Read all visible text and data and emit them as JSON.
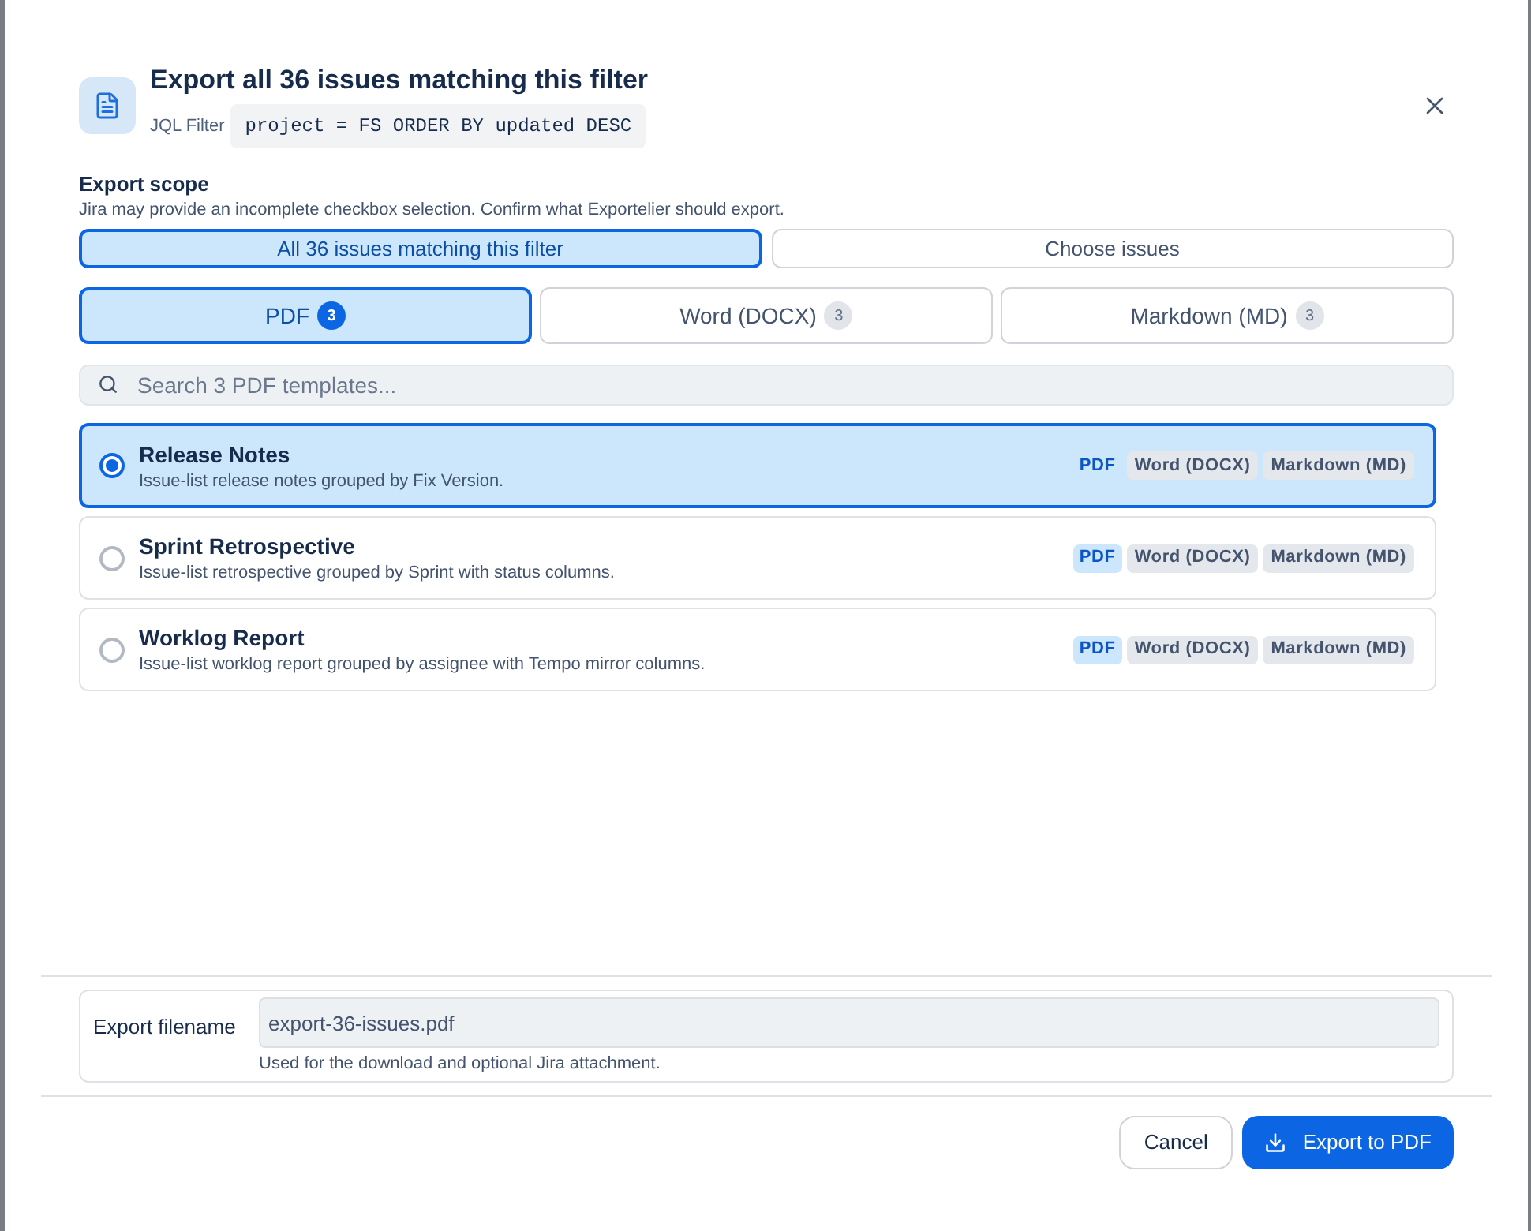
{
  "dialog": {
    "title": "Export all 36 issues matching this filter",
    "filter_label": "JQL Filter",
    "filter_query": "project = FS ORDER BY updated DESC"
  },
  "scope": {
    "heading": "Export scope",
    "hint": "Jira may provide an incomplete checkbox selection. Confirm what Exportelier should export.",
    "options": [
      {
        "label": "All 36 issues matching this filter",
        "selected": true
      },
      {
        "label": "Choose issues",
        "selected": false
      }
    ]
  },
  "format_tabs": [
    {
      "label": "PDF",
      "count": "3",
      "selected": true
    },
    {
      "label": "Word (DOCX)",
      "count": "3",
      "selected": false
    },
    {
      "label": "Markdown (MD)",
      "count": "3",
      "selected": false
    }
  ],
  "search": {
    "placeholder": "Search 3 PDF templates..."
  },
  "templates": [
    {
      "title": "Release Notes",
      "description": "Issue-list release notes grouped by Fix Version.",
      "selected": true,
      "formats": [
        {
          "label": "PDF",
          "kind": "primary"
        },
        {
          "label": "Word (DOCX)",
          "kind": "secondary"
        },
        {
          "label": "Markdown (MD)",
          "kind": "secondary"
        }
      ]
    },
    {
      "title": "Sprint Retrospective",
      "description": "Issue-list retrospective grouped by Sprint with status columns.",
      "selected": false,
      "formats": [
        {
          "label": "PDF",
          "kind": "primary"
        },
        {
          "label": "Word (DOCX)",
          "kind": "secondary"
        },
        {
          "label": "Markdown (MD)",
          "kind": "secondary"
        }
      ]
    },
    {
      "title": "Worklog Report",
      "description": "Issue-list worklog report grouped by assignee with Tempo mirror columns.",
      "selected": false,
      "formats": [
        {
          "label": "PDF",
          "kind": "primary"
        },
        {
          "label": "Word (DOCX)",
          "kind": "secondary"
        },
        {
          "label": "Markdown (MD)",
          "kind": "secondary"
        }
      ]
    }
  ],
  "filename": {
    "label": "Export filename",
    "value": "export-36-issues.pdf",
    "hint": "Used for the download and optional Jira attachment."
  },
  "buttons": [
    {
      "label": "Cancel",
      "kind": "secondary"
    },
    {
      "label": "Export to PDF",
      "kind": "primary"
    }
  ]
}
